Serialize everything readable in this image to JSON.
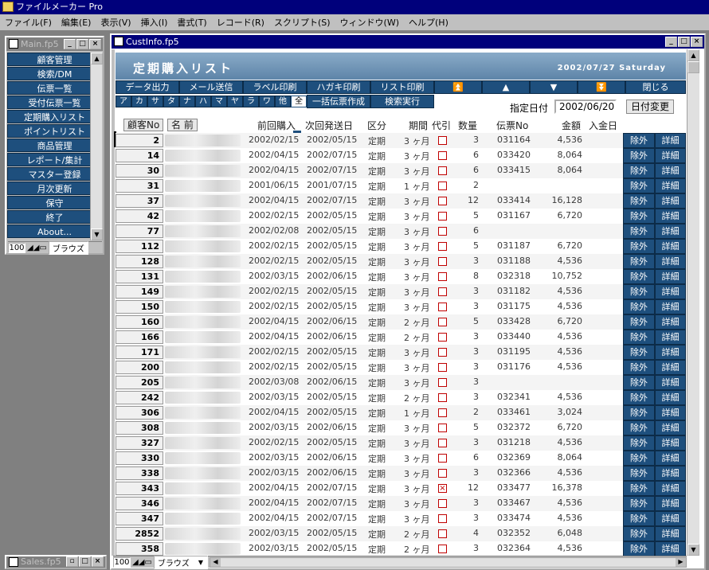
{
  "app": {
    "title": "ファイルメーカー Pro"
  },
  "menu": [
    "ファイル(F)",
    "編集(E)",
    "表示(V)",
    "挿入(I)",
    "書式(T)",
    "レコード(R)",
    "スクリプト(S)",
    "ウィンドウ(W)",
    "ヘルプ(H)"
  ],
  "main_window": {
    "title": "Main.fp5",
    "zoom": "100",
    "mode": "ブラウズ",
    "nav": [
      "顧客管理",
      "検索/DM",
      "伝票一覧",
      "受付伝票一覧",
      "定期購入リスト",
      "ポイントリスト",
      "商品管理",
      "レポート/集計",
      "マスター登録",
      "月次更新",
      "保守",
      "終了",
      "About..."
    ]
  },
  "sales_window": {
    "title": "Sales.fp5"
  },
  "cust_window": {
    "title": "CustInfo.fp5",
    "zoom": "100",
    "mode": "ブラウズ"
  },
  "header": {
    "title": "定期購入リスト",
    "date": "2002/07/27 Saturday"
  },
  "toolbar": {
    "buttons": [
      "データ出力",
      "メール送信",
      "ラベル印刷",
      "ハガキ印刷",
      "リスト印刷"
    ],
    "nav_first": "⏫",
    "nav_prev": "▲",
    "nav_next": "▼",
    "nav_last": "⏬",
    "close": "閉じる",
    "kana": [
      "ア",
      "カ",
      "サ",
      "タ",
      "ナ",
      "ハ",
      "マ",
      "ヤ",
      "ラ",
      "ワ",
      "他",
      "全"
    ],
    "bulk": "一括伝票作成",
    "search": "検索実行",
    "date_label": "指定日付",
    "date_value": "2002/06/20",
    "date_change": "日付変更"
  },
  "columns": {
    "no": "顧客No",
    "name": "名 前",
    "prev": "前回購入",
    "next": "次回発送日",
    "kubun": "区分",
    "kikan": "期間",
    "daibiki": "代引",
    "qty": "数量",
    "denpyo": "伝票No",
    "amount": "金額",
    "nyukin": "入金日"
  },
  "row_buttons": {
    "exclude": "除外",
    "detail": "詳細"
  },
  "rows": [
    {
      "no": "2",
      "prev": "2002/02/15",
      "next": "2002/05/15",
      "kubun": "定期",
      "kikan": "3 ヶ月",
      "checked": false,
      "qty": "3",
      "den": "031164",
      "amt": "4,536"
    },
    {
      "no": "14",
      "prev": "2002/04/15",
      "next": "2002/07/15",
      "kubun": "定期",
      "kikan": "3 ヶ月",
      "checked": false,
      "qty": "6",
      "den": "033420",
      "amt": "8,064"
    },
    {
      "no": "30",
      "prev": "2002/04/15",
      "next": "2002/07/15",
      "kubun": "定期",
      "kikan": "3 ヶ月",
      "checked": false,
      "qty": "6",
      "den": "033415",
      "amt": "8,064"
    },
    {
      "no": "31",
      "prev": "2001/06/15",
      "next": "2001/07/15",
      "kubun": "定期",
      "kikan": "1 ヶ月",
      "checked": false,
      "qty": "2",
      "den": "",
      "amt": ""
    },
    {
      "no": "37",
      "prev": "2002/04/15",
      "next": "2002/07/15",
      "kubun": "定期",
      "kikan": "3 ヶ月",
      "checked": false,
      "qty": "12",
      "den": "033414",
      "amt": "16,128"
    },
    {
      "no": "42",
      "prev": "2002/02/15",
      "next": "2002/05/15",
      "kubun": "定期",
      "kikan": "3 ヶ月",
      "checked": false,
      "qty": "5",
      "den": "031167",
      "amt": "6,720"
    },
    {
      "no": "77",
      "prev": "2002/02/08",
      "next": "2002/05/15",
      "kubun": "定期",
      "kikan": "3 ヶ月",
      "checked": false,
      "qty": "6",
      "den": "",
      "amt": ""
    },
    {
      "no": "112",
      "prev": "2002/02/15",
      "next": "2002/05/15",
      "kubun": "定期",
      "kikan": "3 ヶ月",
      "checked": false,
      "qty": "5",
      "den": "031187",
      "amt": "6,720"
    },
    {
      "no": "128",
      "prev": "2002/02/15",
      "next": "2002/05/15",
      "kubun": "定期",
      "kikan": "3 ヶ月",
      "checked": false,
      "qty": "3",
      "den": "031188",
      "amt": "4,536"
    },
    {
      "no": "131",
      "prev": "2002/03/15",
      "next": "2002/06/15",
      "kubun": "定期",
      "kikan": "3 ヶ月",
      "checked": false,
      "qty": "8",
      "den": "032318",
      "amt": "10,752"
    },
    {
      "no": "149",
      "prev": "2002/02/15",
      "next": "2002/05/15",
      "kubun": "定期",
      "kikan": "3 ヶ月",
      "checked": false,
      "qty": "3",
      "den": "031182",
      "amt": "4,536"
    },
    {
      "no": "150",
      "prev": "2002/02/15",
      "next": "2002/05/15",
      "kubun": "定期",
      "kikan": "3 ヶ月",
      "checked": false,
      "qty": "3",
      "den": "031175",
      "amt": "4,536"
    },
    {
      "no": "160",
      "prev": "2002/04/15",
      "next": "2002/06/15",
      "kubun": "定期",
      "kikan": "2 ヶ月",
      "checked": false,
      "qty": "5",
      "den": "033428",
      "amt": "6,720"
    },
    {
      "no": "166",
      "prev": "2002/04/15",
      "next": "2002/06/15",
      "kubun": "定期",
      "kikan": "2 ヶ月",
      "checked": false,
      "qty": "3",
      "den": "033440",
      "amt": "4,536"
    },
    {
      "no": "171",
      "prev": "2002/02/15",
      "next": "2002/05/15",
      "kubun": "定期",
      "kikan": "3 ヶ月",
      "checked": false,
      "qty": "3",
      "den": "031195",
      "amt": "4,536"
    },
    {
      "no": "200",
      "prev": "2002/02/15",
      "next": "2002/05/15",
      "kubun": "定期",
      "kikan": "3 ヶ月",
      "checked": false,
      "qty": "3",
      "den": "031176",
      "amt": "4,536"
    },
    {
      "no": "205",
      "prev": "2002/03/08",
      "next": "2002/06/15",
      "kubun": "定期",
      "kikan": "3 ヶ月",
      "checked": false,
      "qty": "3",
      "den": "",
      "amt": ""
    },
    {
      "no": "242",
      "prev": "2002/03/15",
      "next": "2002/05/15",
      "kubun": "定期",
      "kikan": "2 ヶ月",
      "checked": false,
      "qty": "3",
      "den": "032341",
      "amt": "4,536"
    },
    {
      "no": "306",
      "prev": "2002/04/15",
      "next": "2002/05/15",
      "kubun": "定期",
      "kikan": "1 ヶ月",
      "checked": false,
      "qty": "2",
      "den": "033461",
      "amt": "3,024"
    },
    {
      "no": "308",
      "prev": "2002/03/15",
      "next": "2002/06/15",
      "kubun": "定期",
      "kikan": "3 ヶ月",
      "checked": false,
      "qty": "5",
      "den": "032372",
      "amt": "6,720"
    },
    {
      "no": "327",
      "prev": "2002/02/15",
      "next": "2002/05/15",
      "kubun": "定期",
      "kikan": "3 ヶ月",
      "checked": false,
      "qty": "3",
      "den": "031218",
      "amt": "4,536"
    },
    {
      "no": "330",
      "prev": "2002/03/15",
      "next": "2002/06/15",
      "kubun": "定期",
      "kikan": "3 ヶ月",
      "checked": false,
      "qty": "6",
      "den": "032369",
      "amt": "8,064"
    },
    {
      "no": "338",
      "prev": "2002/03/15",
      "next": "2002/06/15",
      "kubun": "定期",
      "kikan": "3 ヶ月",
      "checked": false,
      "qty": "3",
      "den": "032366",
      "amt": "4,536"
    },
    {
      "no": "343",
      "prev": "2002/04/15",
      "next": "2002/07/15",
      "kubun": "定期",
      "kikan": "3 ヶ月",
      "checked": true,
      "qty": "12",
      "den": "033477",
      "amt": "16,378"
    },
    {
      "no": "346",
      "prev": "2002/04/15",
      "next": "2002/07/15",
      "kubun": "定期",
      "kikan": "3 ヶ月",
      "checked": false,
      "qty": "3",
      "den": "033467",
      "amt": "4,536"
    },
    {
      "no": "347",
      "prev": "2002/04/15",
      "next": "2002/07/15",
      "kubun": "定期",
      "kikan": "3 ヶ月",
      "checked": false,
      "qty": "3",
      "den": "033474",
      "amt": "4,536"
    },
    {
      "no": "2852",
      "prev": "2002/03/15",
      "next": "2002/05/15",
      "kubun": "定期",
      "kikan": "2 ヶ月",
      "checked": false,
      "qty": "4",
      "den": "032352",
      "amt": "6,048"
    },
    {
      "no": "358",
      "prev": "2002/03/15",
      "next": "2002/05/15",
      "kubun": "定期",
      "kikan": "2 ヶ月",
      "checked": false,
      "qty": "3",
      "den": "032364",
      "amt": "4,536"
    }
  ]
}
